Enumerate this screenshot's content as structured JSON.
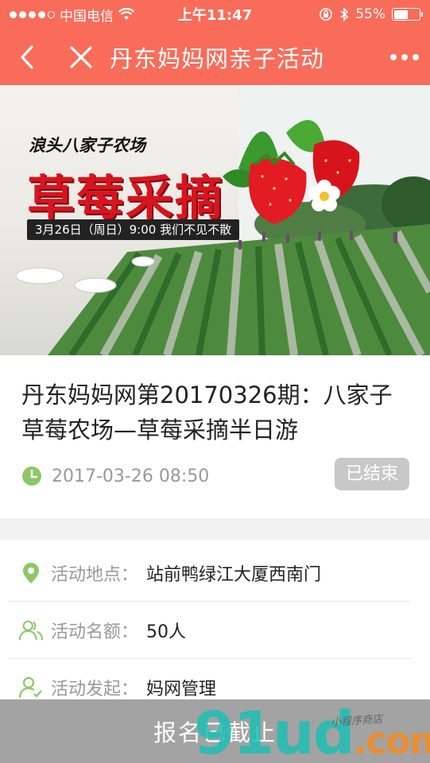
{
  "status_bar": {
    "carrier": "中国电信",
    "time": "上午11:47",
    "battery_percent": "55%",
    "battery_level": 0.55
  },
  "nav": {
    "title": "丹东妈妈网亲子活动",
    "back_icon": "chevron-left-icon",
    "close_icon": "close-icon",
    "more_icon": "more-dots-icon"
  },
  "banner": {
    "farm_name": "浪头八家子农场",
    "headline": "草莓采摘",
    "date_line": "3月26日（周日）9:00 我们不见不散"
  },
  "event": {
    "title": "丹东妈妈网第20170326期：八家子草莓农场—草莓采摘半日游",
    "datetime": "2017-03-26 08:50",
    "status_badge": "已结束"
  },
  "details": [
    {
      "icon": "location-pin-icon",
      "label": "活动地点：",
      "value": "站前鸭绿江大厦西南门"
    },
    {
      "icon": "users-icon",
      "label": "活动名额：",
      "value": "50人"
    },
    {
      "icon": "user-check-icon",
      "label": "活动发起：",
      "value": "妈网管理"
    }
  ],
  "bottom_bar": {
    "button_label": "报名已截止"
  },
  "watermark": {
    "brand": "91ud",
    "suffix": ".com",
    "tagline": "小程序商店"
  },
  "colors": {
    "header": "#f96c5a",
    "accent_green": "#8dc76a",
    "disabled_gray": "#a3a3a3"
  }
}
